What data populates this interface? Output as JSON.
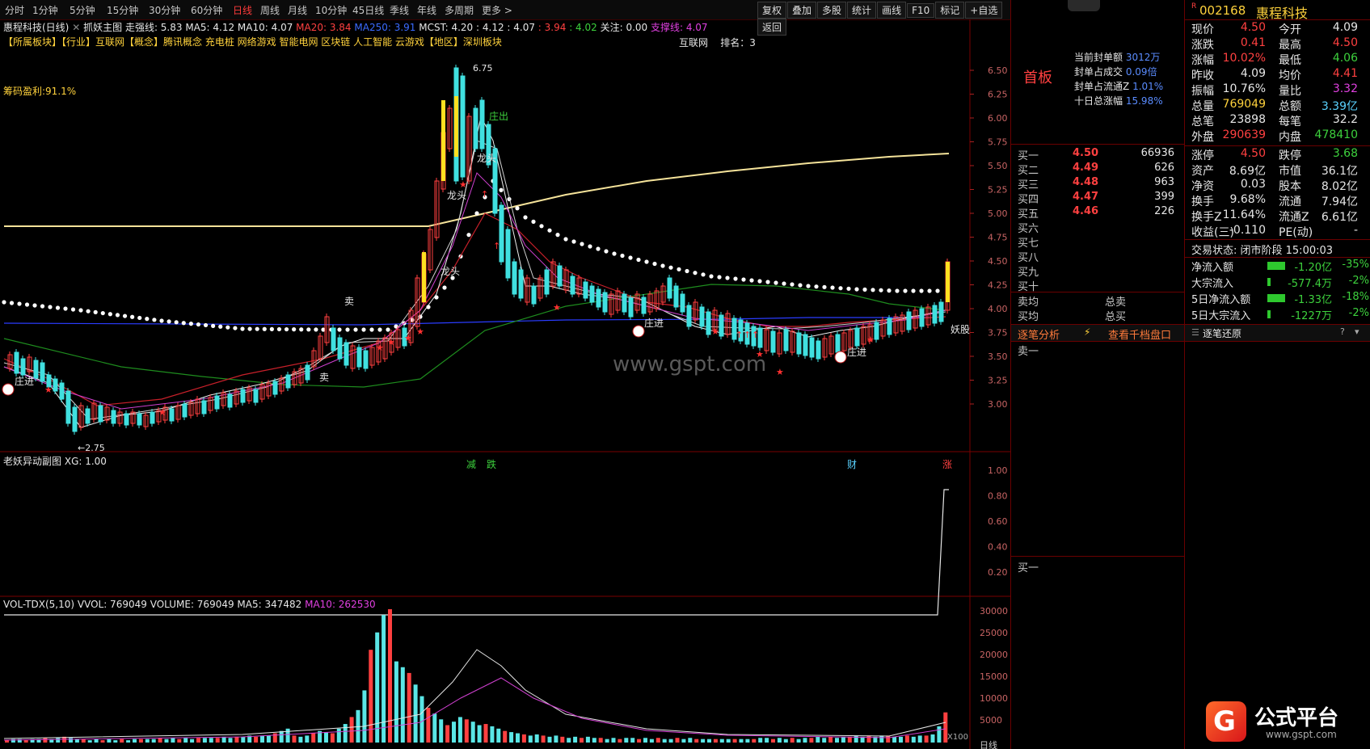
{
  "toolbar": {
    "periods": [
      "分时",
      "1分钟",
      "5分钟",
      "15分钟",
      "30分钟",
      "60分钟",
      "日线",
      "周线",
      "月线",
      "10分钟",
      "45日线",
      "季线",
      "年线",
      "多周期",
      "更多 >"
    ],
    "active_period": "日线",
    "right_buttons": [
      "复权",
      "叠加",
      "多股",
      "统计",
      "画线",
      "F10",
      "标记",
      "+自选",
      "返回"
    ]
  },
  "main_chart": {
    "title": "惠程科技(日线)",
    "indicator_name": "抓妖主图",
    "indicators": [
      {
        "label": "走强线: 5.83",
        "color": "#e6e6e6"
      },
      {
        "label": "MA5: 4.12",
        "color": "#e6e6e6"
      },
      {
        "label": "MA10: 4.07",
        "color": "#e6e6e6"
      },
      {
        "label": "MA20: 3.84",
        "color": "#ff4040"
      },
      {
        "label": "MA250: 3.91",
        "color": "#3b6bff"
      },
      {
        "label": "MCST: 4.20",
        "color": "#e6e6e6"
      },
      {
        "label": ": 4.12",
        "color": "#e6e6e6"
      },
      {
        "label": ": 4.07",
        "color": "#e6e6e6"
      },
      {
        "label": ": 3.94",
        "color": "#ff4040"
      },
      {
        "label": ": 4.02",
        "color": "#3dd13d"
      },
      {
        "label": "关注: 0.00",
        "color": "#e6e6e6"
      },
      {
        "label": "支撑线: 4.07",
        "color": "#e040e0"
      }
    ],
    "sectors": "【所属板块】【行业】互联网【概念】腾讯概念 充电桩 网络游戏 智能电网 区块链 人工智能 云游戏【地区】深圳板块",
    "chip_profit": "筹码盈利:91.1%",
    "rank_info": "互联网    排名：3",
    "watermark": "www.gspt.com",
    "price_axis": [
      "6.50",
      "6.25",
      "6.00",
      "5.75",
      "5.50",
      "5.25",
      "5.00",
      "4.75",
      "4.50",
      "4.25",
      "4.00",
      "3.75",
      "3.50",
      "3.25",
      "3.00"
    ],
    "labels": {
      "high": "6.75",
      "low": "2.75",
      "zhuangchu": "庄出",
      "longtou1": "龙头",
      "longtou2": "龙头",
      "longtou3": "龙头",
      "sell1": "卖",
      "sell2": "卖",
      "zhuang1": "庄进",
      "zhuang2": "庄进",
      "zhuang3": "庄进",
      "yaogu": "妖股",
      "jian": "减",
      "die": "跌",
      "cai": "财",
      "zhang": "涨"
    }
  },
  "sub_chart1": {
    "title": "老妖异动副图",
    "xg": "XG: 1.00",
    "axis": [
      "1.00",
      "0.80",
      "0.60",
      "0.40",
      "0.20"
    ]
  },
  "sub_chart2": {
    "title": "VOL-TDX(5,10)",
    "values": [
      {
        "label": "VVOL: 769049",
        "color": "#e6e6e6"
      },
      {
        "label": "VOLUME: 769049",
        "color": "#e6e6e6"
      },
      {
        "label": "MA5: 347482",
        "color": "#e6e6e6"
      },
      {
        "label": "MA10: 262530",
        "color": "#e040e0"
      }
    ],
    "axis": [
      "30000",
      "25000",
      "20000",
      "15000",
      "10000",
      "5000"
    ],
    "unit": "X100",
    "date_label": "日线"
  },
  "mid_panel": {
    "title": "首板",
    "stats": [
      {
        "label": "当前封单额",
        "value": "3012万"
      },
      {
        "label": "封单占成交",
        "value": "0.09倍"
      },
      {
        "label": "封单占流通Z",
        "value": "1.01%"
      },
      {
        "label": "十日总涨幅",
        "value": "15.98%"
      }
    ],
    "bids": [
      {
        "label": "买一",
        "price": "4.50",
        "vol": "66936"
      },
      {
        "label": "买二",
        "price": "4.49",
        "vol": "626"
      },
      {
        "label": "买三",
        "price": "4.48",
        "vol": "963"
      },
      {
        "label": "买四",
        "price": "4.47",
        "vol": "399"
      },
      {
        "label": "买五",
        "price": "4.46",
        "vol": "226"
      },
      {
        "label": "买六",
        "price": "",
        "vol": ""
      },
      {
        "label": "买七",
        "price": "",
        "vol": ""
      },
      {
        "label": "买八",
        "price": "",
        "vol": ""
      },
      {
        "label": "买九",
        "price": "",
        "vol": ""
      },
      {
        "label": "买十",
        "price": "",
        "vol": ""
      }
    ],
    "avg": [
      {
        "label": "卖均",
        "total": "总卖"
      },
      {
        "label": "买均",
        "total": "总买"
      }
    ],
    "tab1": "逐笔分析",
    "tab2": "查看千档盘口",
    "sell_first": "卖一",
    "buy_first": "买一"
  },
  "quote": {
    "code": "002168",
    "name": "惠程科技",
    "rows": [
      {
        "l": "现价",
        "v": "4.50",
        "vc": "#ff4040",
        "l2": "今开",
        "v2": "4.09",
        "v2c": "#e6e6e6"
      },
      {
        "l": "涨跌",
        "v": "0.41",
        "vc": "#ff4040",
        "l2": "最高",
        "v2": "4.50",
        "v2c": "#ff4040"
      },
      {
        "l": "涨幅",
        "v": "10.02%",
        "vc": "#ff4040",
        "l2": "最低",
        "v2": "4.06",
        "v2c": "#3dd13d"
      },
      {
        "l": "昨收",
        "v": "4.09",
        "vc": "#e6e6e6",
        "l2": "均价",
        "v2": "4.41",
        "v2c": "#ff4040"
      },
      {
        "l": "振幅",
        "v": "10.76%",
        "vc": "#e6e6e6",
        "l2": "量比",
        "v2": "3.32",
        "v2c": "#e040e0"
      },
      {
        "l": "总量",
        "v": "769049",
        "vc": "#ffd23c",
        "l2": "总额",
        "v2": "3.39亿",
        "v2c": "#5ad2ff"
      },
      {
        "l": "总笔",
        "v": "23898",
        "vc": "#e6e6e6",
        "l2": "每笔",
        "v2": "32.2",
        "v2c": "#e6e6e6"
      },
      {
        "l": "外盘",
        "v": "290639",
        "vc": "#ff4040",
        "l2": "内盘",
        "v2": "478410",
        "v2c": "#3dd13d"
      }
    ],
    "rows2": [
      {
        "l": "涨停",
        "v": "4.50",
        "vc": "#ff4040",
        "l2": "跌停",
        "v2": "3.68",
        "v2c": "#3dd13d"
      },
      {
        "l": "资产",
        "v": "8.69亿",
        "vc": "#e6e6e6",
        "l2": "市值",
        "v2": "36.1亿",
        "v2c": "#e6e6e6"
      },
      {
        "l": "净资",
        "v": "0.03",
        "vc": "#e6e6e6",
        "l2": "股本",
        "v2": "8.02亿",
        "v2c": "#e6e6e6"
      },
      {
        "l": "换手",
        "v": "9.68%",
        "vc": "#e6e6e6",
        "l2": "流通",
        "v2": "7.94亿",
        "v2c": "#e6e6e6"
      },
      {
        "l": "换手Z",
        "v": "11.64%",
        "vc": "#e6e6e6",
        "l2": "流通Z",
        "v2": "6.61亿",
        "v2c": "#e6e6e6"
      },
      {
        "l": "收益(三)",
        "v": "-0.110",
        "vc": "#e6e6e6",
        "l2": "PE(动)",
        "v2": "-",
        "v2c": "#e6e6e6"
      }
    ],
    "trade_status": "交易状态: 闭市阶段 15:00:03",
    "flows": [
      {
        "l": "净流入额",
        "v": "-1.20亿",
        "p": "-35%"
      },
      {
        "l": "大宗流入",
        "v": "-577.4万",
        "p": "-2%"
      },
      {
        "l": "5日净流入额",
        "v": "-1.33亿",
        "p": "-18%"
      },
      {
        "l": "5日大宗流入",
        "v": "-1227万",
        "p": "-2%"
      }
    ],
    "restore_title": "逐笔还原",
    "logo_text": "公式平台",
    "logo_url": "www.gspt.com"
  }
}
